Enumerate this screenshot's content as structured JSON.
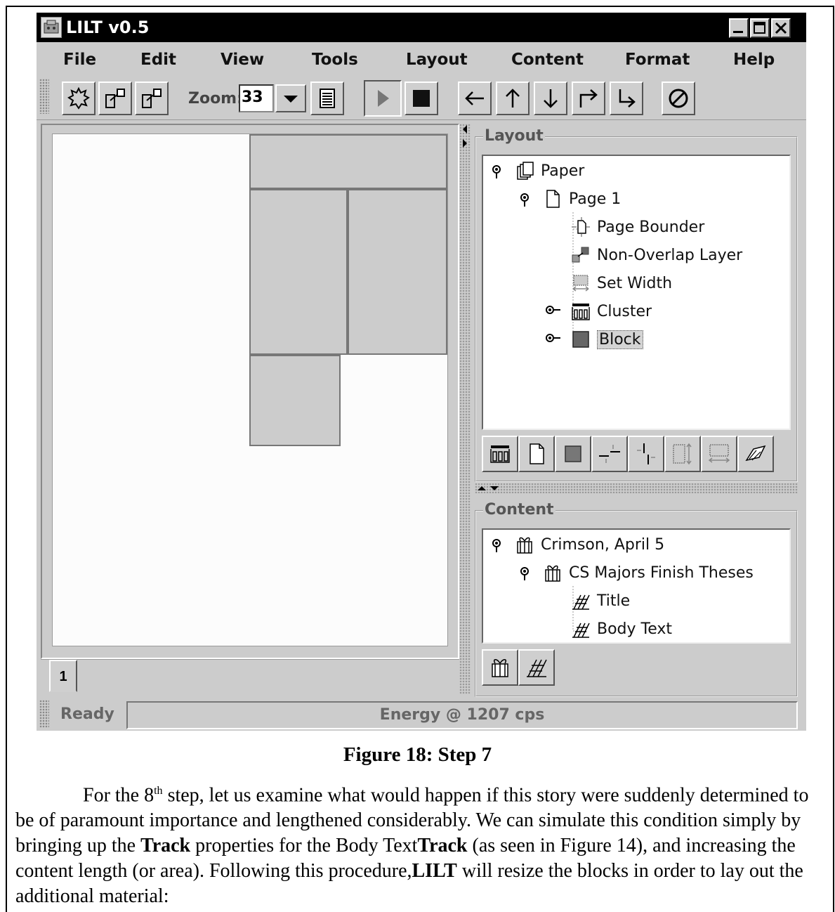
{
  "window": {
    "title": "LILT v0.5"
  },
  "menu": [
    "File",
    "Edit",
    "View",
    "Tools",
    "Layout",
    "Content",
    "Format",
    "Help"
  ],
  "toolbar": {
    "zoom_label": "Zoom:",
    "zoom_value": "33",
    "buttons": [
      "new-layout-icon",
      "export-icon",
      "export-alt-icon",
      "properties-icon",
      "play-icon",
      "stop-icon",
      "arrow-left-icon",
      "arrow-up-icon",
      "arrow-down-icon",
      "turn-right-icon",
      "turn-down-icon",
      "no-entry-icon"
    ]
  },
  "canvas": {
    "page_tab": "1"
  },
  "layout_panel": {
    "title": "Layout",
    "tree": [
      {
        "label": "Paper",
        "icon": "paper-icon"
      },
      {
        "label": "Page 1",
        "icon": "page-icon"
      },
      {
        "label": "Page Bounder",
        "icon": "page-bounder-icon"
      },
      {
        "label": "Non-Overlap Layer",
        "icon": "non-overlap-icon"
      },
      {
        "label": "Set Width",
        "icon": "set-width-icon"
      },
      {
        "label": "Cluster",
        "icon": "cluster-icon"
      },
      {
        "label": "Block",
        "icon": "block-icon",
        "selected": true
      }
    ],
    "tools": [
      "cluster-icon",
      "page-icon",
      "block-icon",
      "h-align-icon",
      "v-align-icon",
      "set-height-icon",
      "set-width-icon",
      "connector-icon"
    ]
  },
  "content_panel": {
    "title": "Content",
    "tree": [
      {
        "label": "Crimson, April 5",
        "icon": "gift-icon"
      },
      {
        "label": "CS Majors Finish Theses",
        "icon": "gift-icon"
      },
      {
        "label": "Title",
        "icon": "track-icon"
      },
      {
        "label": "Body Text",
        "icon": "track-icon"
      }
    ],
    "tools": [
      "gift-icon",
      "track-icon"
    ]
  },
  "status": {
    "left": "Ready",
    "right": "Energy @ 1207 cps"
  },
  "document": {
    "caption": "Figure 18: Step 7",
    "p_1": "For the 8",
    "p_sup": "th",
    "p_2": " step, let us examine what would happen if this story were suddenly determined to be of paramount importance and lengthened considerably.  We can simulate this condition simply by bringing up the ",
    "p_b1": "Track",
    "p_3": " properties for the Body Text",
    "p_b2": "Track",
    "p_4": " (as seen in Figure 14), and increasing the content length (or area).  Following this procedure,",
    "p_b3": "LILT",
    "p_5": " will resize the blocks in order to lay out the additional material:"
  }
}
